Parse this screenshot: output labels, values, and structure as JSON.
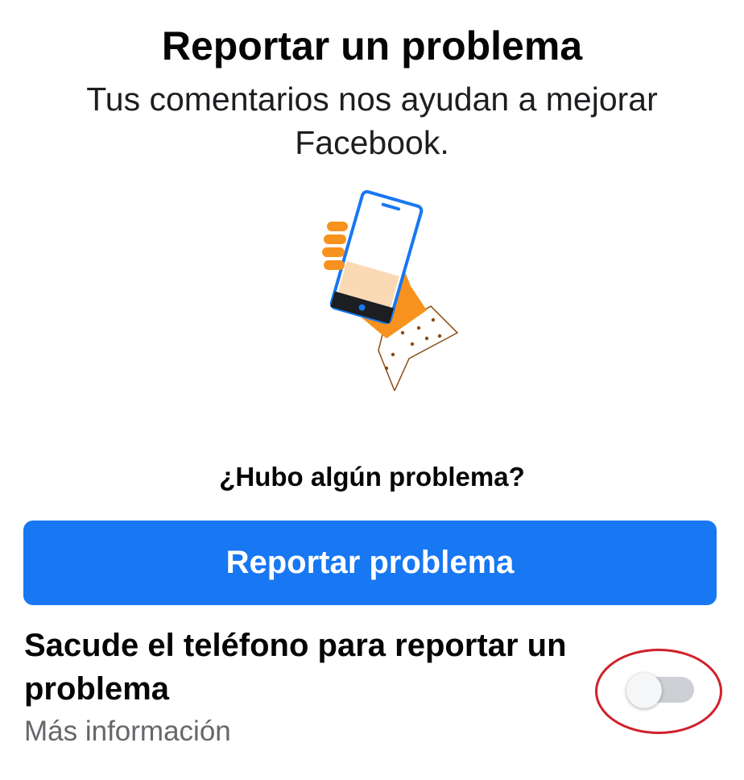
{
  "header": {
    "title": "Reportar un problema",
    "subtitle": "Tus comentarios nos ayudan a mejorar Facebook."
  },
  "illustration": {
    "icon": "hand-holding-phone-icon",
    "colors": {
      "phone_frame": "#1877f2",
      "hand": "#f7921e",
      "screen_fill": "#fbd9b5",
      "phone_bottom": "#1c1e21"
    }
  },
  "main": {
    "question": "¿Hubo algún problema?",
    "report_button_label": "Reportar problema"
  },
  "shake_setting": {
    "label": "Sacude el teléfono para reportar un problema",
    "more_info": "Más información",
    "toggle_on": false
  },
  "colors": {
    "accent": "#1877f2",
    "secondary_text": "#65676b",
    "annotation_ring": "#d0202a"
  }
}
